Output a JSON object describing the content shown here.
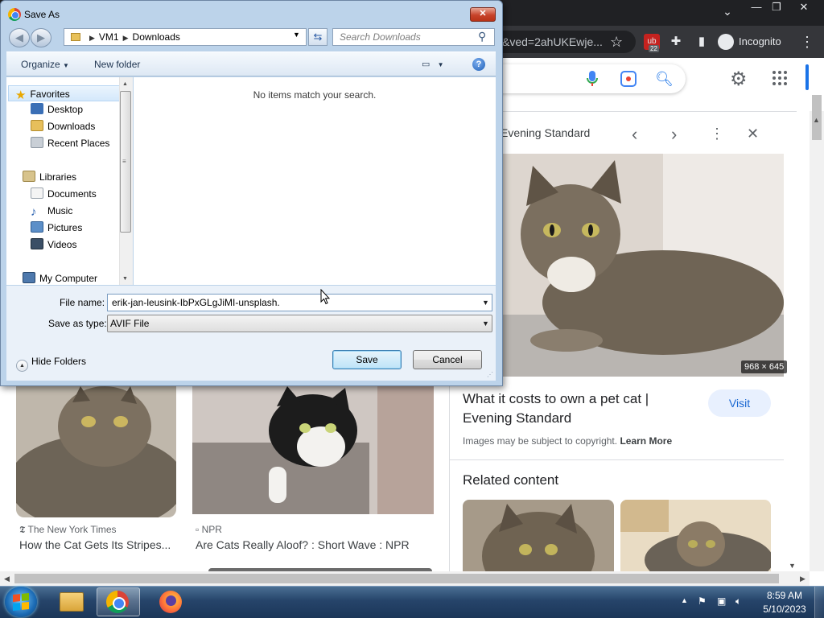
{
  "browser": {
    "url_fragment": "&ved=2ahUKEwje...",
    "extension_badge": "22",
    "incognito_label": "Incognito"
  },
  "panel": {
    "source": "Evening Standard",
    "image_dims": "968 × 645",
    "title": "What it costs to own a pet cat | Evening Standard",
    "visit_label": "Visit",
    "copyright_note": "Images may be subject to copyright.",
    "learn_more": "Learn More",
    "related_heading": "Related content"
  },
  "results": [
    {
      "source": "The New York Times",
      "title": "How the Cat Gets Its Stripes..."
    },
    {
      "source": "NPR",
      "title": "Are Cats Really Aloof? : Short Wave : NPR"
    }
  ],
  "dialog": {
    "title": "Save As",
    "breadcrumb": [
      "VM1",
      "Downloads"
    ],
    "search_placeholder": "Search Downloads",
    "organize_label": "Organize",
    "new_folder_label": "New folder",
    "help_label": "?",
    "nav_items": {
      "favorites": "Favorites",
      "desktop": "Desktop",
      "downloads": "Downloads",
      "recent_places": "Recent Places",
      "libraries": "Libraries",
      "documents": "Documents",
      "music": "Music",
      "pictures": "Pictures",
      "videos": "Videos",
      "my_computer": "My Computer"
    },
    "empty_message": "No items match your search.",
    "filename_label": "File name:",
    "filename_value": "erik-jan-leusink-IbPxGLgJiMI-unsplash.",
    "filetype_label": "Save as type:",
    "filetype_value": "AVIF File",
    "hide_folders_label": "Hide Folders",
    "save_label": "Save",
    "cancel_label": "Cancel"
  },
  "taskbar": {
    "time": "8:59 AM",
    "date": "5/10/2023"
  },
  "colors": {
    "chrome_dark": "#202124",
    "google_blue": "#1a73e8",
    "dialog_frame": "#bcd3ea",
    "taskbar": "#26446a"
  }
}
